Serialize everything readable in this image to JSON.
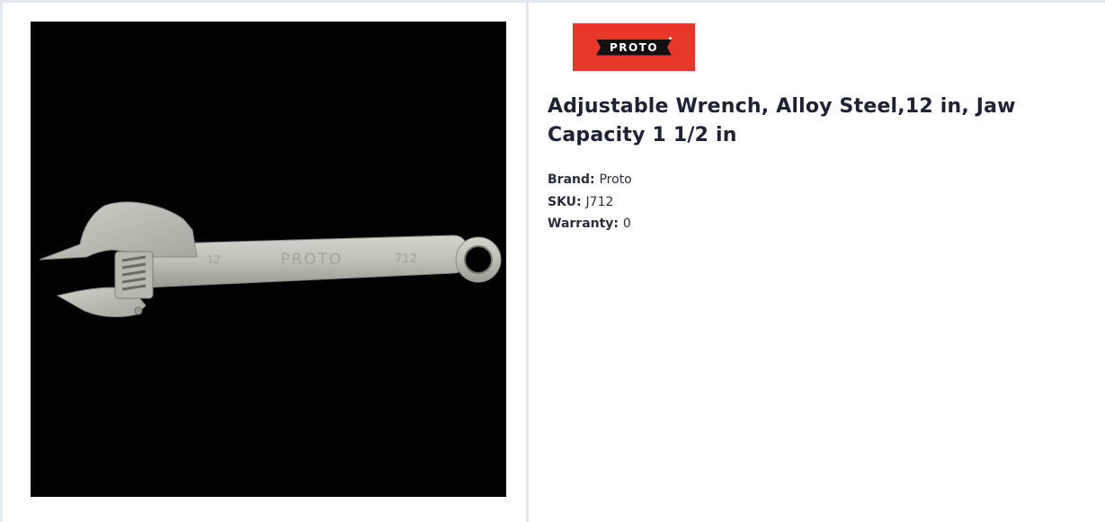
{
  "product": {
    "title": "Adjustable Wrench, Alloy Steel,12 in, Jaw Capacity 1 1/2 in",
    "image_alt": "Proto adjustable wrench",
    "wrench_markings": {
      "size_mark": "12",
      "brand_mark": "PROTO",
      "model_mark": "712"
    }
  },
  "brand_logo": {
    "text": "PROTO",
    "background_color": "#e8372a"
  },
  "specs": [
    {
      "label": "Brand:",
      "value": "Proto"
    },
    {
      "label": "SKU:",
      "value": "J712"
    },
    {
      "label": "Warranty:",
      "value": "0"
    }
  ],
  "colors": {
    "title": "#1f2233",
    "border": "#e4e7ee",
    "image_background": "#000000"
  }
}
